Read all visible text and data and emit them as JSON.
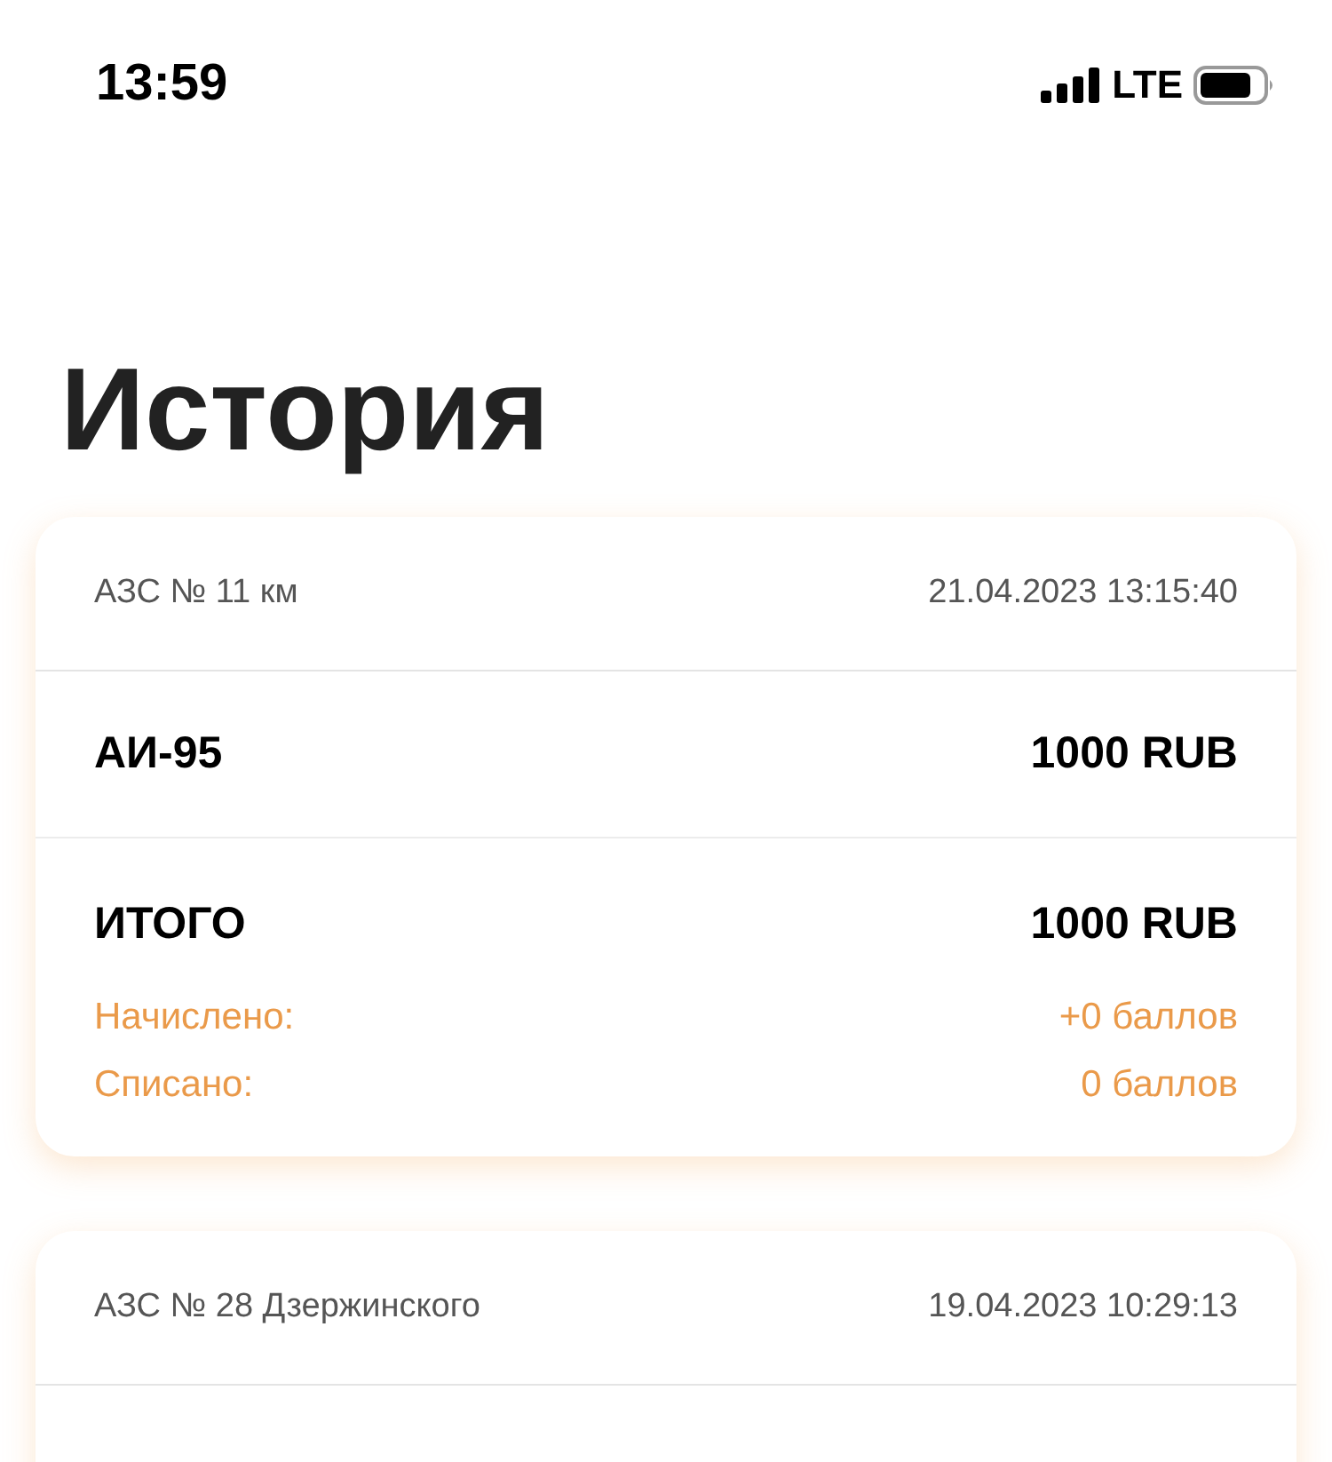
{
  "status_bar": {
    "time": "13:59",
    "network": "LTE"
  },
  "title": "История",
  "transactions": [
    {
      "station": "АЗС № 11 км",
      "datetime": "21.04.2023 13:15:40",
      "items": [
        {
          "name": "АИ-95",
          "amount": "1000 RUB"
        }
      ],
      "total_label": "ИТОГО",
      "total": "1000 RUB",
      "accrued_label": "Начислено:",
      "accrued": "+0 баллов",
      "spent_label": "Списано:",
      "spent": "0 баллов"
    },
    {
      "station": "АЗС № 28 Дзержинского",
      "datetime": "19.04.2023 10:29:13"
    }
  ]
}
